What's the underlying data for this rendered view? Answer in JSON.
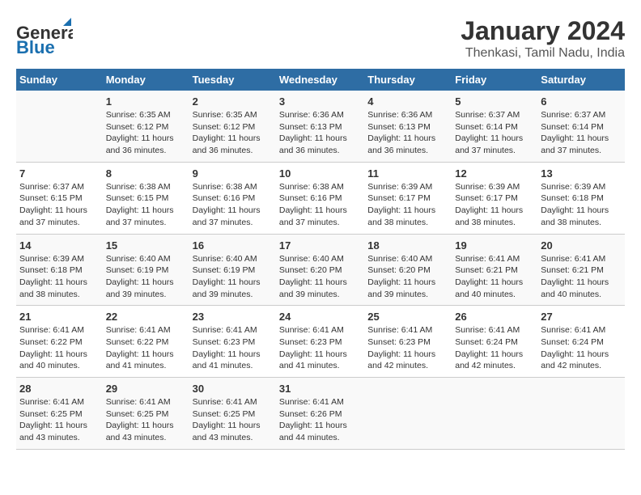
{
  "logo": {
    "part1": "General",
    "part2": "Blue"
  },
  "title": "January 2024",
  "subtitle": "Thenkasi, Tamil Nadu, India",
  "days_header": [
    "Sunday",
    "Monday",
    "Tuesday",
    "Wednesday",
    "Thursday",
    "Friday",
    "Saturday"
  ],
  "weeks": [
    [
      {
        "num": "",
        "info": ""
      },
      {
        "num": "1",
        "info": "Sunrise: 6:35 AM\nSunset: 6:12 PM\nDaylight: 11 hours\nand 36 minutes."
      },
      {
        "num": "2",
        "info": "Sunrise: 6:35 AM\nSunset: 6:12 PM\nDaylight: 11 hours\nand 36 minutes."
      },
      {
        "num": "3",
        "info": "Sunrise: 6:36 AM\nSunset: 6:13 PM\nDaylight: 11 hours\nand 36 minutes."
      },
      {
        "num": "4",
        "info": "Sunrise: 6:36 AM\nSunset: 6:13 PM\nDaylight: 11 hours\nand 36 minutes."
      },
      {
        "num": "5",
        "info": "Sunrise: 6:37 AM\nSunset: 6:14 PM\nDaylight: 11 hours\nand 37 minutes."
      },
      {
        "num": "6",
        "info": "Sunrise: 6:37 AM\nSunset: 6:14 PM\nDaylight: 11 hours\nand 37 minutes."
      }
    ],
    [
      {
        "num": "7",
        "info": "Sunrise: 6:37 AM\nSunset: 6:15 PM\nDaylight: 11 hours\nand 37 minutes."
      },
      {
        "num": "8",
        "info": "Sunrise: 6:38 AM\nSunset: 6:15 PM\nDaylight: 11 hours\nand 37 minutes."
      },
      {
        "num": "9",
        "info": "Sunrise: 6:38 AM\nSunset: 6:16 PM\nDaylight: 11 hours\nand 37 minutes."
      },
      {
        "num": "10",
        "info": "Sunrise: 6:38 AM\nSunset: 6:16 PM\nDaylight: 11 hours\nand 37 minutes."
      },
      {
        "num": "11",
        "info": "Sunrise: 6:39 AM\nSunset: 6:17 PM\nDaylight: 11 hours\nand 38 minutes."
      },
      {
        "num": "12",
        "info": "Sunrise: 6:39 AM\nSunset: 6:17 PM\nDaylight: 11 hours\nand 38 minutes."
      },
      {
        "num": "13",
        "info": "Sunrise: 6:39 AM\nSunset: 6:18 PM\nDaylight: 11 hours\nand 38 minutes."
      }
    ],
    [
      {
        "num": "14",
        "info": "Sunrise: 6:39 AM\nSunset: 6:18 PM\nDaylight: 11 hours\nand 38 minutes."
      },
      {
        "num": "15",
        "info": "Sunrise: 6:40 AM\nSunset: 6:19 PM\nDaylight: 11 hours\nand 39 minutes."
      },
      {
        "num": "16",
        "info": "Sunrise: 6:40 AM\nSunset: 6:19 PM\nDaylight: 11 hours\nand 39 minutes."
      },
      {
        "num": "17",
        "info": "Sunrise: 6:40 AM\nSunset: 6:20 PM\nDaylight: 11 hours\nand 39 minutes."
      },
      {
        "num": "18",
        "info": "Sunrise: 6:40 AM\nSunset: 6:20 PM\nDaylight: 11 hours\nand 39 minutes."
      },
      {
        "num": "19",
        "info": "Sunrise: 6:41 AM\nSunset: 6:21 PM\nDaylight: 11 hours\nand 40 minutes."
      },
      {
        "num": "20",
        "info": "Sunrise: 6:41 AM\nSunset: 6:21 PM\nDaylight: 11 hours\nand 40 minutes."
      }
    ],
    [
      {
        "num": "21",
        "info": "Sunrise: 6:41 AM\nSunset: 6:22 PM\nDaylight: 11 hours\nand 40 minutes."
      },
      {
        "num": "22",
        "info": "Sunrise: 6:41 AM\nSunset: 6:22 PM\nDaylight: 11 hours\nand 41 minutes."
      },
      {
        "num": "23",
        "info": "Sunrise: 6:41 AM\nSunset: 6:23 PM\nDaylight: 11 hours\nand 41 minutes."
      },
      {
        "num": "24",
        "info": "Sunrise: 6:41 AM\nSunset: 6:23 PM\nDaylight: 11 hours\nand 41 minutes."
      },
      {
        "num": "25",
        "info": "Sunrise: 6:41 AM\nSunset: 6:23 PM\nDaylight: 11 hours\nand 42 minutes."
      },
      {
        "num": "26",
        "info": "Sunrise: 6:41 AM\nSunset: 6:24 PM\nDaylight: 11 hours\nand 42 minutes."
      },
      {
        "num": "27",
        "info": "Sunrise: 6:41 AM\nSunset: 6:24 PM\nDaylight: 11 hours\nand 42 minutes."
      }
    ],
    [
      {
        "num": "28",
        "info": "Sunrise: 6:41 AM\nSunset: 6:25 PM\nDaylight: 11 hours\nand 43 minutes."
      },
      {
        "num": "29",
        "info": "Sunrise: 6:41 AM\nSunset: 6:25 PM\nDaylight: 11 hours\nand 43 minutes."
      },
      {
        "num": "30",
        "info": "Sunrise: 6:41 AM\nSunset: 6:25 PM\nDaylight: 11 hours\nand 43 minutes."
      },
      {
        "num": "31",
        "info": "Sunrise: 6:41 AM\nSunset: 6:26 PM\nDaylight: 11 hours\nand 44 minutes."
      },
      {
        "num": "",
        "info": ""
      },
      {
        "num": "",
        "info": ""
      },
      {
        "num": "",
        "info": ""
      }
    ]
  ]
}
